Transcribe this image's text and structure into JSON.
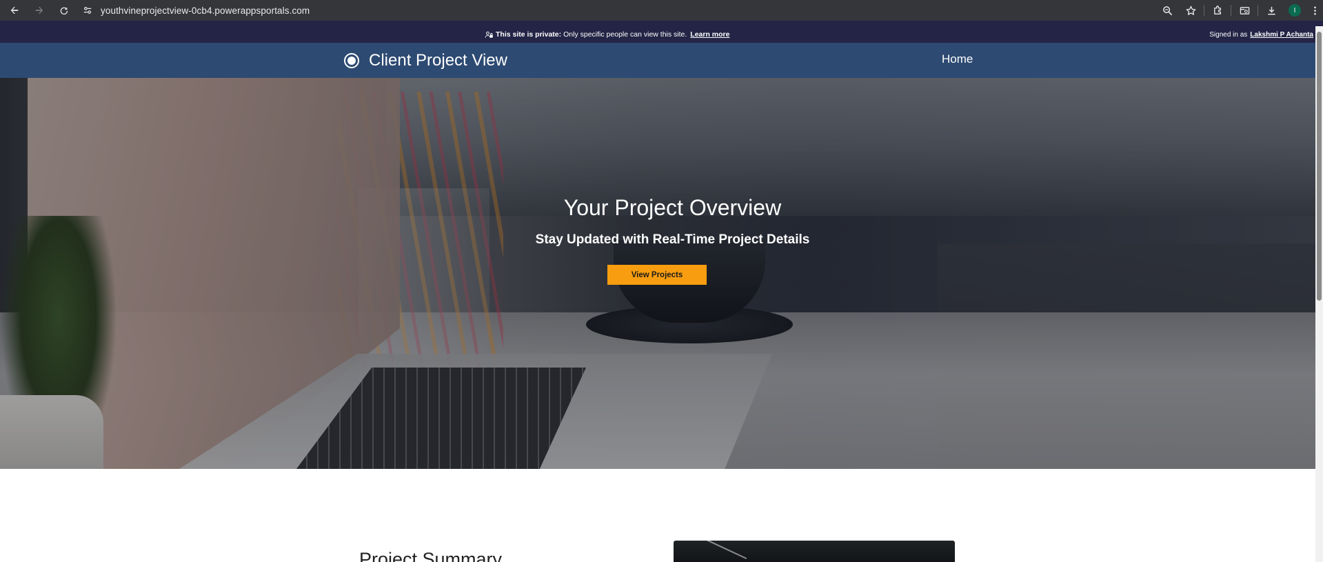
{
  "browser": {
    "url": "youthvineprojectview-0cb4.powerappsportals.com",
    "profile_initial": "I",
    "icons": [
      "back-icon",
      "forward-icon",
      "reload-icon",
      "site-info-icon",
      "zoom-icon",
      "bookmark-star-icon",
      "extensions-icon",
      "tab-search-icon",
      "download-icon",
      "profile-avatar",
      "menu-icon"
    ]
  },
  "banner": {
    "private_label": "This site is private:",
    "private_text": "Only specific people can view this site.",
    "learn_more": "Learn more",
    "signed_in_label": "Signed in as",
    "signed_in_user": "Lakshmi P Achanta"
  },
  "header": {
    "brand_name": "Client Project View",
    "nav_home": "Home"
  },
  "hero": {
    "title": "Your Project Overview",
    "subtitle": "Stay Updated with Real-Time Project Details",
    "button_label": "View Projects"
  },
  "summary": {
    "title": "Project Summary"
  },
  "colors": {
    "banner_bg": "#242446",
    "header_bg": "#2d4a72",
    "button_bg": "#f79d0f",
    "browser_bg": "#35363a"
  }
}
